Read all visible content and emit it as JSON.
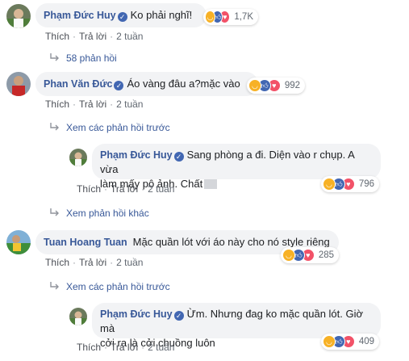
{
  "comments": [
    {
      "name": "Phạm Đức Huy",
      "text": "Ko phải nghĩ!",
      "reacts": "1,7K",
      "like": "Thích",
      "reply": "Trả lời",
      "time": "2 tuần"
    },
    {
      "name": "Phan Văn Đức",
      "text": "Áo vàng đâu a?mặc vào",
      "reacts": "992",
      "like": "Thích",
      "reply": "Trả lời",
      "time": "2 tuần"
    },
    {
      "name": "Phạm Đức Huy",
      "text_line1": "Sang phòng a đi. Diện vào r chụp. A vừa",
      "text_line2": "làm mấy pô ảnh. Chất",
      "reacts": "796",
      "like": "Thích",
      "reply": "Trả lời",
      "time": "2 tuần"
    },
    {
      "name": "Tuan Hoang Tuan",
      "text": "Mặc quần lót với áo này cho nó style riêng",
      "reacts": "285",
      "like": "Thích",
      "reply": "Trả lời",
      "time": "2 tuần"
    },
    {
      "name": "Phạm Đức Huy",
      "text_line1": "Ừm. Nhưng đag ko mặc quần lót. Giờ mà",
      "text_line2": "cởi ra là cởi chuồng luôn",
      "reacts": "409",
      "like": "Thích",
      "reply": "Trả lời",
      "time": "2 tuần"
    }
  ],
  "links": {
    "replies_58": "58 phản hồi",
    "prev_replies_1": "Xem các phản hồi trước",
    "other_replies": "Xem phản hồi khác",
    "prev_replies_2": "Xem các phản hồi trước"
  },
  "icons": {
    "verified": "verified-badge-icon",
    "reply_arrow": "reply-arrow-icon",
    "haha": "haha-reaction-icon",
    "like": "like-reaction-icon",
    "love": "love-reaction-icon"
  },
  "colors": {
    "name": "#385898",
    "bubble": "#f2f3f5",
    "like": "#4267b2",
    "love": "#f25268",
    "haha": "#f7b125"
  }
}
